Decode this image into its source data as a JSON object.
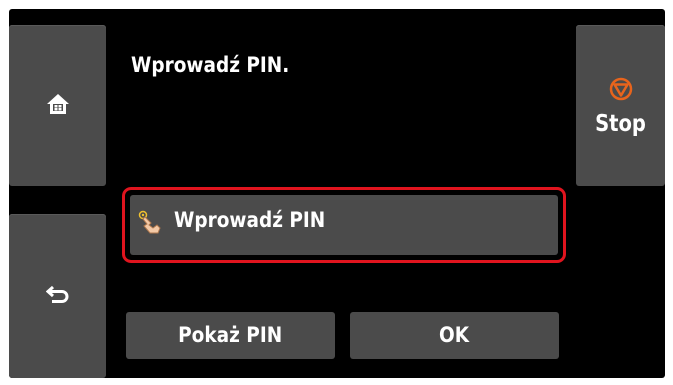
{
  "screen": {
    "message": "Wprowadź PIN."
  },
  "sidebar": {
    "home_icon": "home-icon",
    "back_icon": "back-arrow-icon"
  },
  "stop": {
    "label": "Stop",
    "icon": "stop-icon",
    "icon_color": "#e8641c"
  },
  "pin_field": {
    "label": "Wprowadź PIN",
    "icon": "hand-pointer-icon",
    "highlight_color": "#e0141e"
  },
  "buttons": {
    "show_pin_label": "Pokaż PIN",
    "ok_label": "OK"
  },
  "colors": {
    "background": "#000000",
    "button": "#4b4b4b",
    "text": "#ffffff"
  }
}
